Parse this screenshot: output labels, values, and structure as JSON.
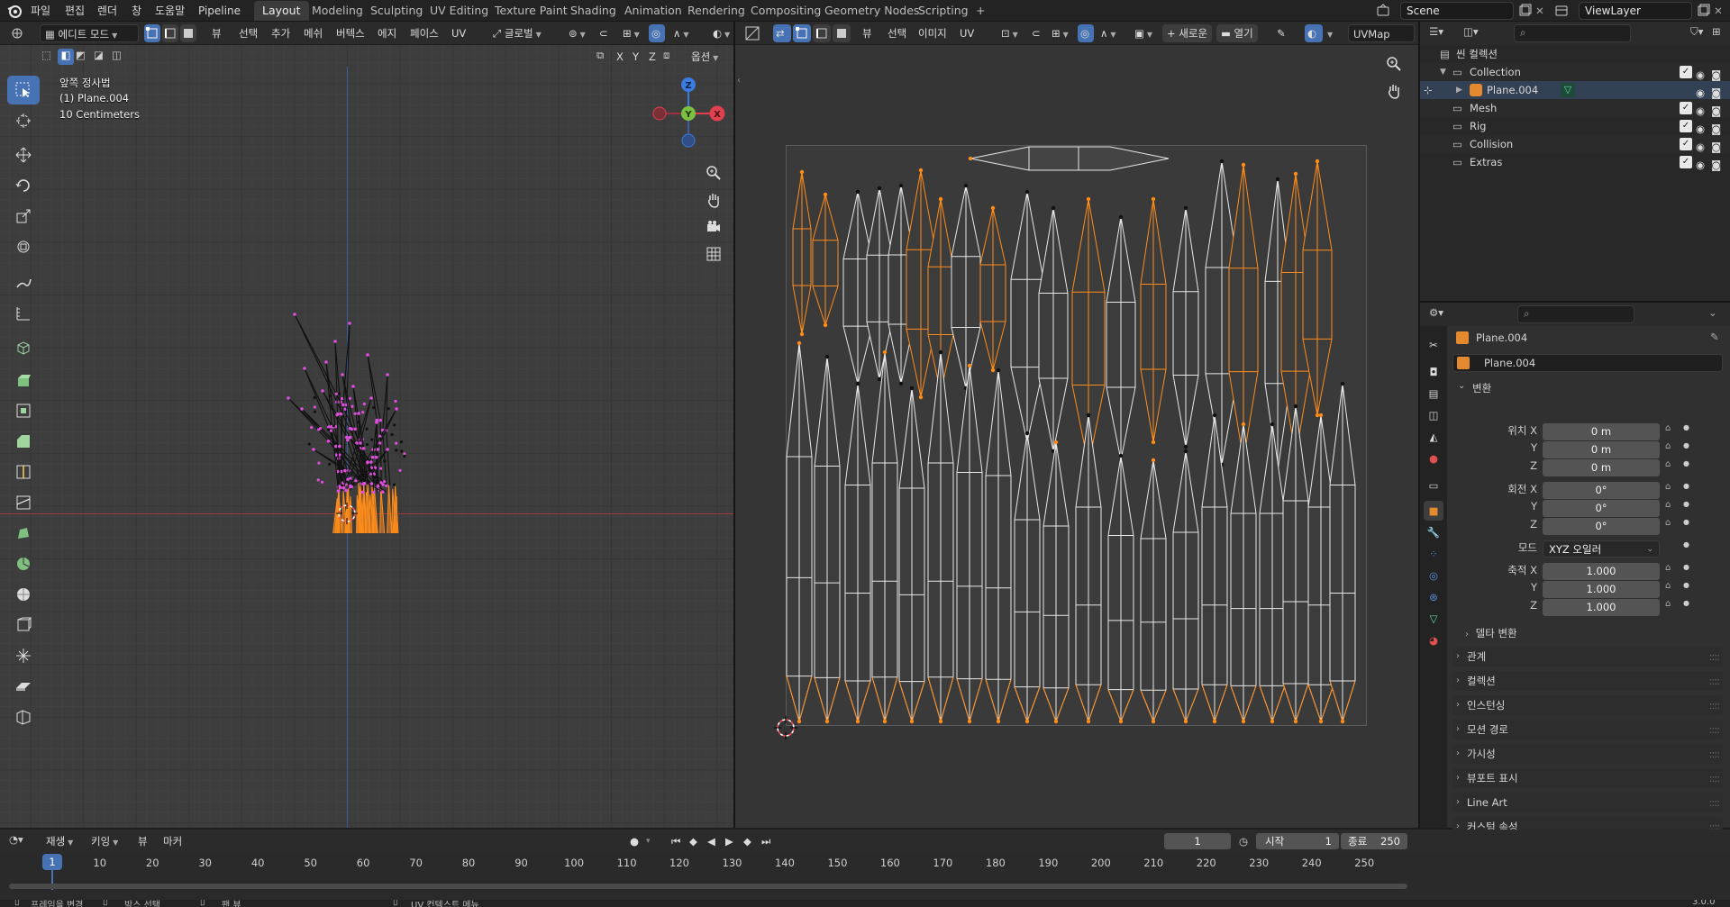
{
  "topbar": {
    "menus": [
      "파일",
      "편집",
      "렌더",
      "창",
      "도움말",
      "Pipeline"
    ],
    "workspaces": [
      "Layout",
      "Modeling",
      "Sculpting",
      "UV Editing",
      "Texture Paint",
      "Shading",
      "Animation",
      "Rendering",
      "Compositing",
      "Geometry Nodes",
      "Scripting"
    ],
    "active_workspace": "Layout",
    "add_workspace": "+",
    "scene": "Scene",
    "view_layer": "ViewLayer"
  },
  "viewport": {
    "mode": "에디트 모드",
    "menus": [
      "뷰",
      "선택",
      "추가",
      "메쉬",
      "버텍스",
      "에지",
      "페이스",
      "UV"
    ],
    "transform_orientation": "글로벌",
    "options": "옵션",
    "axes": [
      "X",
      "Y",
      "Z"
    ],
    "info": [
      "앞쪽 정사법",
      "(1) Plane.004",
      "10 Centimeters"
    ],
    "gizmo": {
      "z": "Z",
      "y": "Y",
      "x": "X"
    }
  },
  "uv_editor": {
    "menus": [
      "뷰",
      "선택",
      "이미지",
      "UV"
    ],
    "new_label": "새로운",
    "open_label": "열기",
    "uvmap": "UVMap"
  },
  "outliner": {
    "search_placeholder": "",
    "rows": [
      {
        "label": "씬 컬렉션",
        "indent": 0
      },
      {
        "label": "Collection",
        "indent": 1
      },
      {
        "label": "Plane.004",
        "indent": 2
      },
      {
        "label": "Mesh",
        "indent": 1
      },
      {
        "label": "Rig",
        "indent": 1
      },
      {
        "label": "Collision",
        "indent": 1
      },
      {
        "label": "Extras",
        "indent": 1
      }
    ]
  },
  "properties": {
    "object_name": "Plane.004",
    "datablock": "Plane.004",
    "transform_header": "변환",
    "location_label": "위치 X",
    "rotation_label": "회전 X",
    "scale_label": "축적 X",
    "y": "Y",
    "z": "Z",
    "location": [
      "0 m",
      "0 m",
      "0 m"
    ],
    "rotation": [
      "0°",
      "0°",
      "0°"
    ],
    "scale": [
      "1.000",
      "1.000",
      "1.000"
    ],
    "mode_label": "모드",
    "mode_value": "XYZ 오일러",
    "delta": "델타 변환",
    "sections": [
      "관계",
      "컬렉션",
      "인스턴싱",
      "모션 경로",
      "가시성",
      "뷰포트 표시",
      "Line Art",
      "커스텀 속성"
    ]
  },
  "timeline": {
    "menus": [
      "재생",
      "키잉",
      "뷰",
      "마커"
    ],
    "current_frame": "1",
    "start_label": "시작",
    "start": "1",
    "end_label": "종료",
    "end": "250",
    "ticks": [
      "1",
      "10",
      "20",
      "30",
      "40",
      "50",
      "60",
      "70",
      "80",
      "90",
      "100",
      "110",
      "120",
      "130",
      "140",
      "150",
      "160",
      "170",
      "180",
      "190",
      "200",
      "210",
      "220",
      "230",
      "240",
      "250"
    ]
  },
  "status": {
    "items": [
      "프레임을 변경",
      "박스 선택",
      "팬 뷰",
      "UV 컨텍스트 메뉴"
    ],
    "version": "3.0.0"
  },
  "colors": {
    "accent": "#4772b3",
    "selected": "#ff8c1a",
    "vertex": "#e04ee0"
  }
}
